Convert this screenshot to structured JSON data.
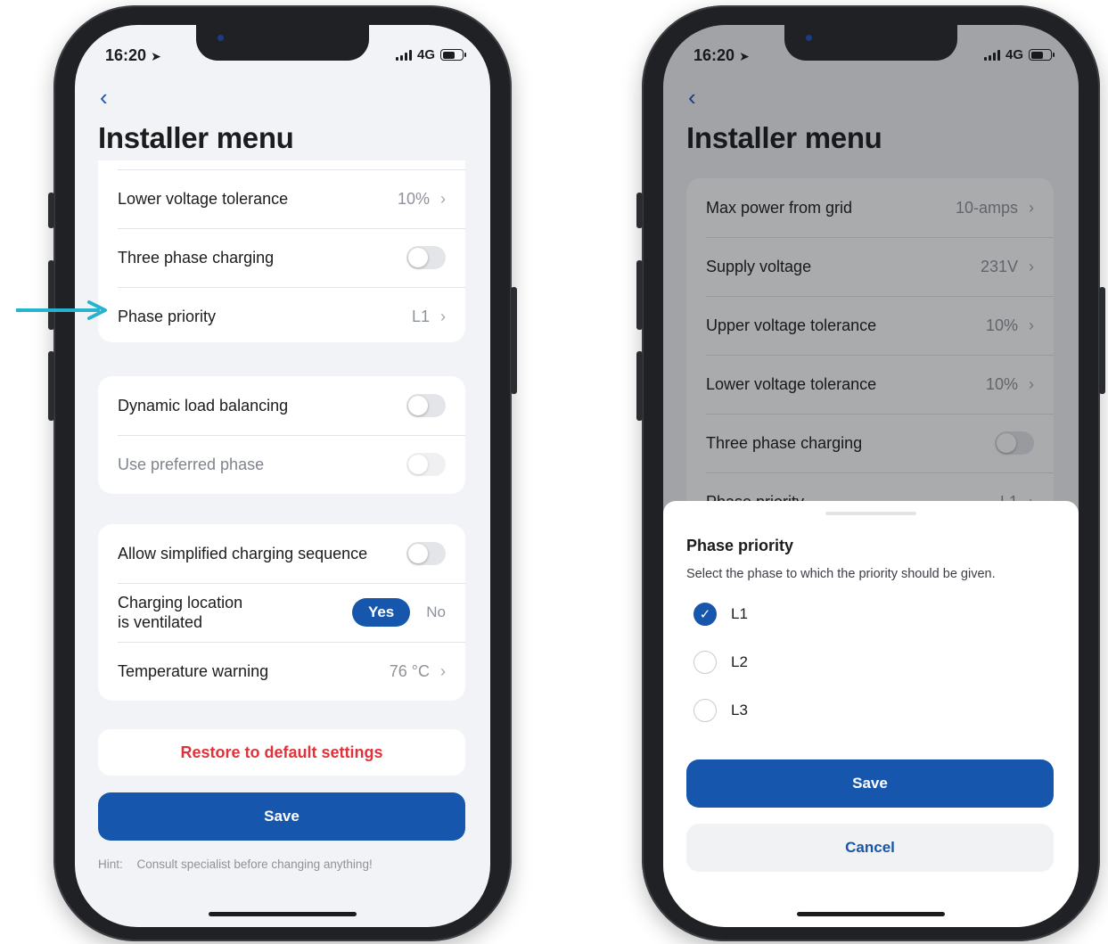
{
  "left_phone": {
    "status": {
      "time": "16:20",
      "network": "4G"
    },
    "back_label": "‹",
    "title": "Installer menu",
    "group1": [
      {
        "label": "Lower voltage tolerance",
        "value": "10%"
      },
      {
        "label": "Three phase charging"
      },
      {
        "label": "Phase priority",
        "value": "L1"
      }
    ],
    "group2": [
      {
        "label": "Dynamic load balancing"
      },
      {
        "label": "Use preferred phase"
      }
    ],
    "group3": [
      {
        "label": "Allow simplified charging sequence"
      },
      {
        "label_line1": "Charging location",
        "label_line2": "is ventilated",
        "yes": "Yes",
        "no": "No"
      },
      {
        "label": "Temperature warning",
        "value": "76 °C"
      }
    ],
    "restore_label": "Restore to default settings",
    "save_label": "Save",
    "hint_label": "Hint:",
    "hint_text": "Consult specialist before changing anything!"
  },
  "right_phone": {
    "status": {
      "time": "16:20",
      "network": "4G"
    },
    "back_label": "‹",
    "title": "Installer menu",
    "list": [
      {
        "label": "Max power from grid",
        "value": "10-amps"
      },
      {
        "label": "Supply voltage",
        "value": "231V"
      },
      {
        "label": "Upper voltage tolerance",
        "value": "10%"
      },
      {
        "label": "Lower voltage tolerance",
        "value": "10%"
      },
      {
        "label": "Three phase charging"
      },
      {
        "label": "Phase priority",
        "value": "L1"
      }
    ],
    "sheet": {
      "title": "Phase priority",
      "description": "Select the phase to which the priority should be given.",
      "options": [
        "L1",
        "L2",
        "L3"
      ],
      "selected": "L1",
      "save_label": "Save",
      "cancel_label": "Cancel"
    }
  },
  "colors": {
    "accent": "#1756ad",
    "danger": "#e0323a",
    "pointer_arrow": "#27b3cf"
  },
  "icons": [
    "back-chevron-icon",
    "chevron-right-icon",
    "location-arrow-icon",
    "signal-icon",
    "battery-icon",
    "check-icon",
    "pointer-arrow-icon"
  ]
}
